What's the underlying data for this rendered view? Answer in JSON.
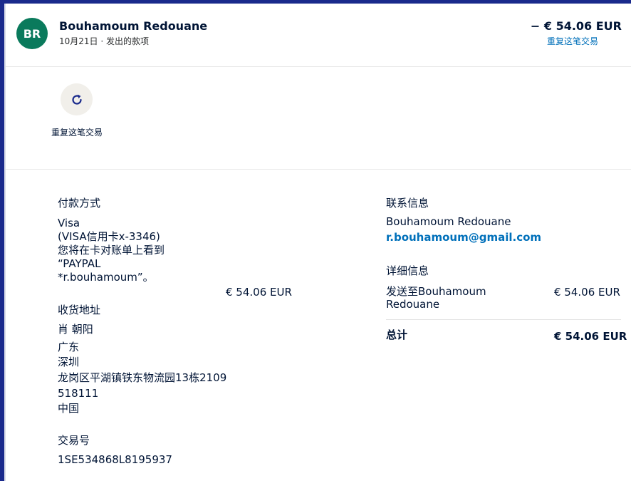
{
  "header": {
    "avatar_initials": "BR",
    "payee_name": "Bouhamoum Redouane",
    "date": "10月21日",
    "separator": " · ",
    "type": "发出的款项",
    "amount": "− € 54.06 EUR",
    "repeat_link": "重复这笔交易"
  },
  "actions": {
    "repeat_icon": "refresh-icon",
    "repeat_label": "重复这笔交易"
  },
  "payment": {
    "title": "付款方式",
    "method": "Visa",
    "card": "(VISA信用卡x-3346)",
    "statement_line1": "您将在卡对账单上看到",
    "statement_line2": "“PAYPAL",
    "statement_line3": "*r.bouhamoum”。",
    "amount": "€ 54.06 EUR"
  },
  "shipping": {
    "title": "收货地址",
    "lines": [
      "肖 朝阳",
      "广东",
      "深圳",
      "龙岗区平湖镇铁东物流园13栋2109",
      "518111",
      "中国"
    ]
  },
  "transaction": {
    "title": "交易号",
    "id": "1SE534868L8195937"
  },
  "contact": {
    "title": "联系信息",
    "name": "Bouhamoum Redouane",
    "email": "r.bouhamoum@gmail.com"
  },
  "details": {
    "title": "详细信息",
    "sent_to_line1": "发送至Bouhamoum",
    "sent_to_line2": "Redouane",
    "sent_amount": "€ 54.06 EUR",
    "total_label": "总计",
    "total_amount": "€ 54.06 EUR"
  },
  "colors": {
    "avatar_bg": "#0a7a5c",
    "link": "#0070ba",
    "frame": "#1a2a8c"
  }
}
